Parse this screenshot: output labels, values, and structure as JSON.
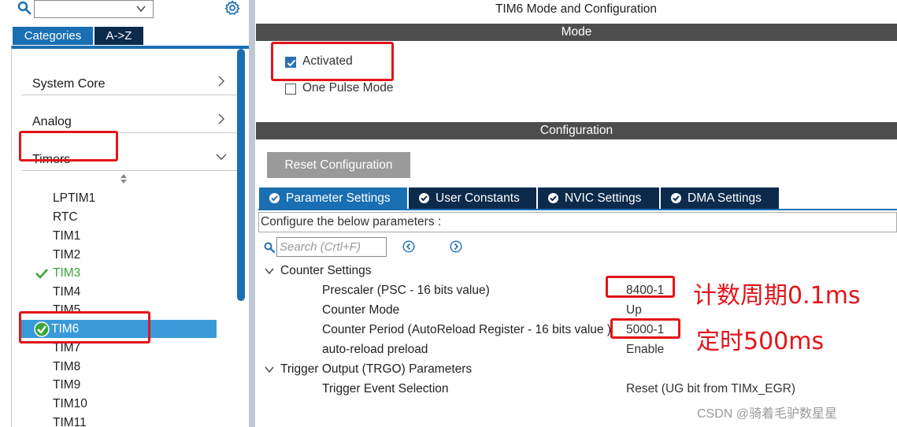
{
  "left_panel": {
    "tabs": [
      "Categories",
      "A->Z"
    ],
    "categories": [
      {
        "label": "System Core"
      },
      {
        "label": "Analog"
      },
      {
        "label": "Timers"
      }
    ],
    "timers": [
      {
        "label": "LPTIM1"
      },
      {
        "label": "RTC"
      },
      {
        "label": "TIM1"
      },
      {
        "label": "TIM2"
      },
      {
        "label": "TIM3"
      },
      {
        "label": "TIM4"
      },
      {
        "label": "TIM5"
      },
      {
        "label": "TIM6"
      },
      {
        "label": "TIM7"
      },
      {
        "label": "TIM8"
      },
      {
        "label": "TIM9"
      },
      {
        "label": "TIM10"
      },
      {
        "label": "TIM11"
      }
    ]
  },
  "main": {
    "title": "TIM6 Mode and Configuration",
    "mode_header": "Mode",
    "mode_options": [
      {
        "label": "Activated",
        "checked": true
      },
      {
        "label": "One Pulse Mode",
        "checked": false
      }
    ],
    "config_header": "Configuration",
    "reset_button": "Reset Configuration",
    "tabs": [
      "Parameter Settings",
      "User Constants",
      "NVIC Settings",
      "DMA Settings"
    ],
    "hint": "Configure the below parameters :",
    "search_placeholder": "Search (Crtl+F)",
    "groups": [
      {
        "label": "Counter Settings",
        "params": [
          {
            "name": "Prescaler (PSC - 16 bits value)",
            "value": "8400-1"
          },
          {
            "name": "Counter Mode",
            "value": "Up"
          },
          {
            "name": "Counter Period (AutoReload Register - 16 bits value )",
            "value": "5000-1"
          },
          {
            "name": "auto-reload preload",
            "value": "Enable"
          }
        ]
      },
      {
        "label": "Trigger Output (TRGO) Parameters",
        "params": [
          {
            "name": "Trigger Event Selection",
            "value": "Reset (UG bit from TIMx_EGR)"
          }
        ]
      }
    ]
  },
  "annotations": {
    "prescaler_note": "计数周期0.1ms",
    "period_note": "定时500ms"
  },
  "watermark": "CSDN @骑着毛驴数星星",
  "colors": {
    "accent_blue": "#1a6fb3",
    "dark_navy": "#0c2a4c",
    "section_gray": "#4d4d4d",
    "annotation_red": "#e3141b",
    "ok_green": "#3aa53a"
  }
}
